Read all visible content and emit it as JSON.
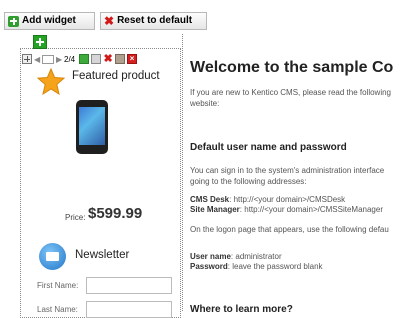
{
  "toolbar": {
    "add_widget": "Add widget",
    "reset_default": "Reset to default"
  },
  "widget_toolbar": {
    "page_indicator": "2/4"
  },
  "featured": {
    "title": "Featured product",
    "price_label": "Price:",
    "price_value": "$599.99"
  },
  "newsletter": {
    "title": "Newsletter",
    "first_name_label": "First Name:",
    "last_name_label": "Last Name:"
  },
  "content": {
    "heading": "Welcome to the sample Co",
    "intro_line1": "If you are new to Kentico CMS, please read the following",
    "intro_line2": "website:",
    "default_heading": "Default user name and password",
    "signin_line1": "You can sign in to the system's administration interface",
    "signin_line2": "going to the following addresses:",
    "cms_desk_label": "CMS Desk",
    "cms_desk_url": ": http://<your domain>/CMSDesk",
    "site_manager_label": "Site Manager",
    "site_manager_url": ": http://<your domain>/CMSSiteManager",
    "logon_line": "On the logon page that appears, use the following defau",
    "user_name_label": "User name",
    "user_name_value": ": administrator",
    "password_label": "Password",
    "password_value": ": leave the password blank",
    "where_heading": "Where to learn more?"
  }
}
